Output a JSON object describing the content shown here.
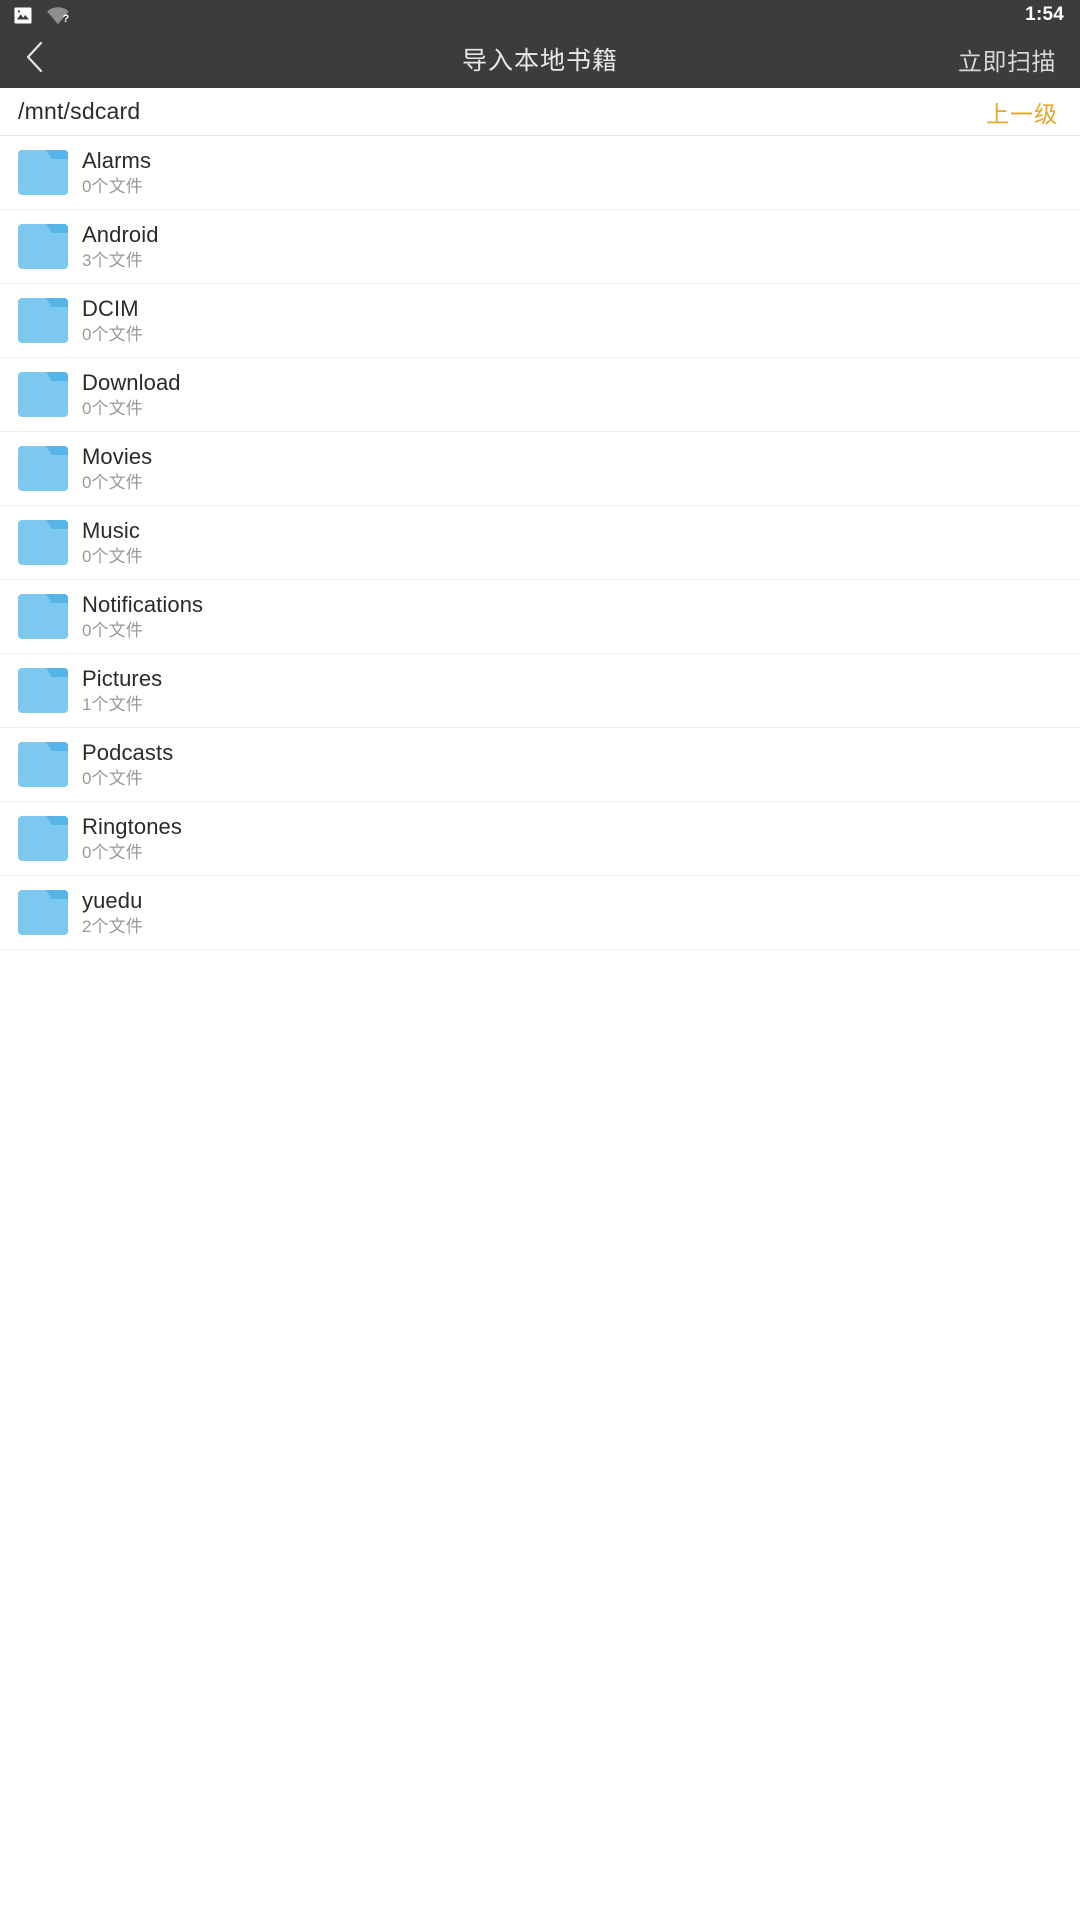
{
  "status_bar": {
    "icons": [
      "photo-icon",
      "wifi-unknown-icon"
    ],
    "time": "1:54",
    "background_color": "#3c3c3c"
  },
  "app_bar": {
    "back_icon": "chevron-left-icon",
    "title": "导入本地书籍",
    "action_label": "立即扫描",
    "background_color": "#3c3c3c"
  },
  "path_bar": {
    "path": "/mnt/sdcard",
    "up_label": "上一级",
    "up_color": "#e4a92b"
  },
  "list": {
    "folder_icon_color": "#7dc8ef",
    "items": [
      {
        "name": "Alarms",
        "count": "0个文件",
        "icon": "folder-icon"
      },
      {
        "name": "Android",
        "count": "3个文件",
        "icon": "folder-icon"
      },
      {
        "name": "DCIM",
        "count": "0个文件",
        "icon": "folder-icon"
      },
      {
        "name": "Download",
        "count": "0个文件",
        "icon": "folder-icon"
      },
      {
        "name": "Movies",
        "count": "0个文件",
        "icon": "folder-icon"
      },
      {
        "name": "Music",
        "count": "0个文件",
        "icon": "folder-icon"
      },
      {
        "name": "Notifications",
        "count": "0个文件",
        "icon": "folder-icon"
      },
      {
        "name": "Pictures",
        "count": "1个文件",
        "icon": "folder-icon"
      },
      {
        "name": "Podcasts",
        "count": "0个文件",
        "icon": "folder-icon"
      },
      {
        "name": "Ringtones",
        "count": "0个文件",
        "icon": "folder-icon"
      },
      {
        "name": "yuedu",
        "count": "2个文件",
        "icon": "folder-icon"
      }
    ]
  }
}
